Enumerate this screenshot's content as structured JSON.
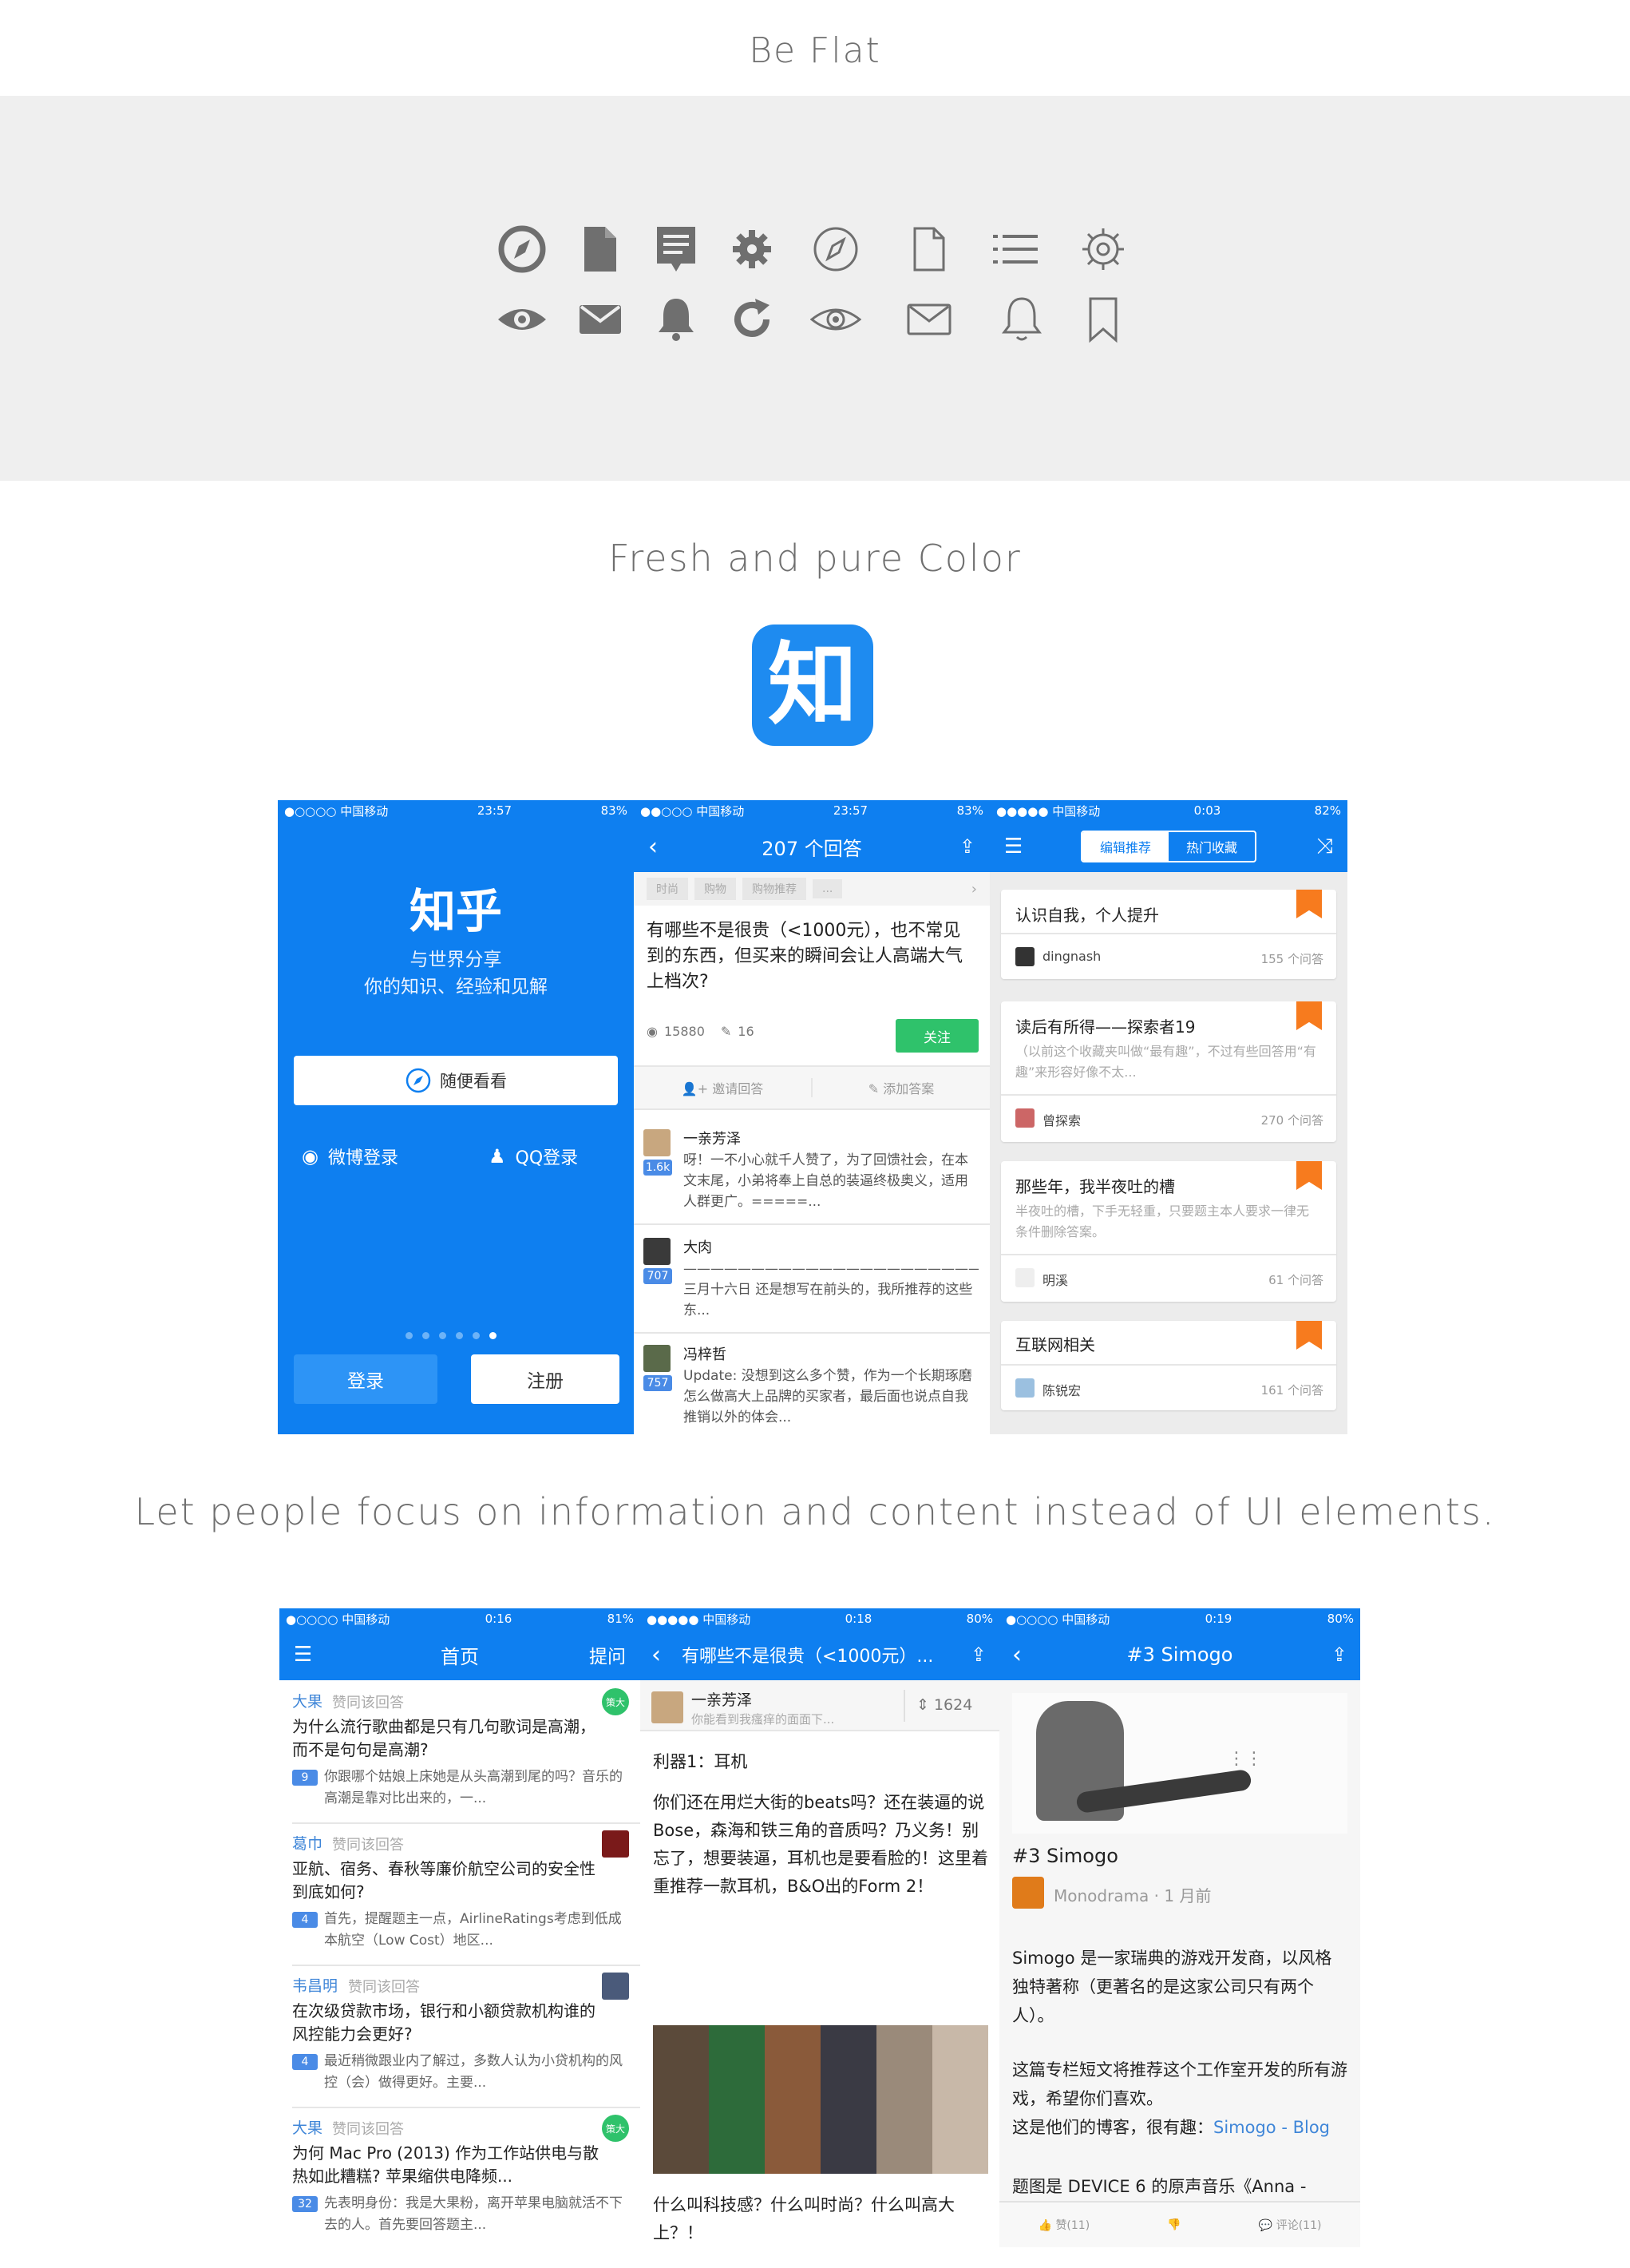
{
  "headings": {
    "be_flat": "Be Flat",
    "fresh": "Fresh and pure  Color",
    "focus": "Let people focus on information and content instead of UI elements."
  },
  "colors": {
    "zhihu_blue": "#0e7ff0",
    "icon_grey": "#6f6f6f",
    "bookmark_orange": "#f77b1e",
    "follow_green": "#2fc26b"
  },
  "icons": {
    "row1": [
      "compass-solid-icon",
      "document-solid-icon",
      "article-solid-icon",
      "gear-solid-icon",
      "compass-outline-icon",
      "document-outline-icon",
      "list-outline-icon",
      "gear-outline-icon"
    ],
    "row2": [
      "eye-solid-icon",
      "mail-solid-icon",
      "bell-solid-icon",
      "refresh-solid-icon",
      "eye-outline-icon",
      "mail-outline-icon",
      "bell-outline-icon",
      "bookmark-outline-icon"
    ]
  },
  "app_icon": {
    "glyph": "知"
  },
  "phone_welcome": {
    "status": {
      "carrier": "●○○○○ 中国移动",
      "time": "23:57",
      "battery": "83%"
    },
    "logo": "知乎",
    "tagline1": "与世界分享",
    "tagline2": "你的知识、经验和见解",
    "browse_button": "随便看看",
    "weibo_login": "微博登录",
    "qq_login": "QQ登录",
    "login_button": "登录",
    "register_button": "注册"
  },
  "phone_question": {
    "status": {
      "carrier": "●●○○○ 中国移动",
      "time": "23:57",
      "battery": "83%"
    },
    "title": "207 个回答",
    "tags": [
      "时尚",
      "购物",
      "购物推荐",
      "..."
    ],
    "question": "有哪些不是很贵（<1000元），也不常见到的东西，但买来的瞬间会让人高端大气上档次?",
    "views": "15880",
    "comments": "16",
    "follow_button": "关注",
    "invite": "邀请回答",
    "add_answer": "添加答案",
    "answers": [
      {
        "author": "一亲芳泽",
        "votes": "1.6k",
        "text": "呀！一不小心就千人赞了，为了回馈社会，在本文末尾，小弟将奉上自总的装逼终极奥义，适用人群更广。=====..."
      },
      {
        "author": "大肉",
        "votes": "707",
        "text": "——————————————————————————————————三月十六日 还是想写在前头的，我所推荐的这些东..."
      },
      {
        "author": "冯梓哲",
        "votes": "757",
        "text": "Update: 没想到这么多个赞，作为一个长期琢磨怎么做高大上品牌的买家者，最后面也说点自我推销以外的体会..."
      }
    ]
  },
  "phone_collections": {
    "status": {
      "carrier": "●●●●● 中国移动",
      "time": "0:03",
      "battery": "82%"
    },
    "seg_edit": "编辑推荐",
    "seg_hot": "热门收藏",
    "cards": [
      {
        "title": "认识自我，个人提升",
        "desc": "",
        "owner": "dingnash",
        "count": "155 个问答"
      },
      {
        "title": "读后有所得——探索者19",
        "desc": "（以前这个收藏夹叫做“最有趣”，不过有些回答用“有趣”来形容好像不太...",
        "owner": "曾探索",
        "count": "270 个问答"
      },
      {
        "title": "那些年，我半夜吐的槽",
        "desc": "半夜吐的槽，下手无轻重，只要题主本人要求一律无条件删除答案。",
        "owner": "明溪",
        "count": "61 个问答"
      },
      {
        "title": "互联网相关",
        "desc": "",
        "owner": "陈锐宏",
        "count": "161 个问答"
      }
    ]
  },
  "phone_feed": {
    "status": {
      "carrier": "●○○○○ 中国移动",
      "time": "0:16",
      "battery": "81%"
    },
    "title": "首页",
    "ask": "提问",
    "items": [
      {
        "user": "大果",
        "action": "赞同该回答",
        "question": "为什么流行歌曲都是只有几句歌词是高潮，而不是句句是高潮?",
        "votes": "9",
        "excerpt": "你跟哪个姑娘上床她是从头高潮到尾的吗？音乐的高潮是靠对比出来的，一..."
      },
      {
        "user": "葛巾",
        "action": "赞同该回答",
        "question": "亚航、宿务、春秋等廉价航空公司的安全性到底如何?",
        "votes": "4",
        "excerpt": "首先，提醒题主一点，AirlineRatings考虑到低成本航空（Low Cost）地区..."
      },
      {
        "user": "韦昌明",
        "action": "赞同该回答",
        "question": "在次级贷款市场，银行和小额贷款机构谁的风控能力会更好?",
        "votes": "4",
        "excerpt": "最近稍微跟业内了解过，多数人认为小贷机构的风控（会）做得更好。主要..."
      },
      {
        "user": "大果",
        "action": "赞同该回答",
        "question": "为何 Mac Pro (2013) 作为工作站供电与散热如此糟糕? 苹果缩供电降频...",
        "votes": "32",
        "excerpt": "先表明身份：我是大果粉，离开苹果电脑就活不下去的人。首先要回答题主..."
      }
    ],
    "badge": "策大"
  },
  "phone_answer": {
    "status": {
      "carrier": "●●●●● 中国移动",
      "time": "0:18",
      "battery": "80%"
    },
    "title": "有哪些不是很贵（<1000元）...",
    "author": "一亲芳泽",
    "author_bio": "你能看到我瘙痒的面面下...",
    "votes": "1624",
    "p1": "利器1：耳机",
    "p2": "你们还在用烂大街的beats吗？还在装逼的说Bose，森海和铁三角的音质吗？乃义务！别忘了，想要装逼，耳机也是要看脸的！这里着重推荐一款耳机，B&O出的Form 2！",
    "p3": "什么叫科技感？什么叫时尚？什么叫高大上？！"
  },
  "phone_article": {
    "status": {
      "carrier": "●○○○○ 中国移动",
      "time": "0:19",
      "battery": "80%"
    },
    "title": "#3 Simogo",
    "article_title": "#3 Simogo",
    "source": "Monodrama · 1 月前",
    "p1": "Simogo 是一家瑞典的游戏开发商，以风格独特著称（更著名的是这家公司只有两个人）。",
    "p2": "这篇专栏短文将推荐这个工作室开发的所有游戏，希望你们喜欢。",
    "p3": "这是他们的博客，很有趣：",
    "link": "Simogo - Blog",
    "p4": "题图是 DEVICE 6 的原声音乐《Anna -",
    "like": "赞(11)",
    "dislike": "",
    "comment": "评论(11)"
  }
}
